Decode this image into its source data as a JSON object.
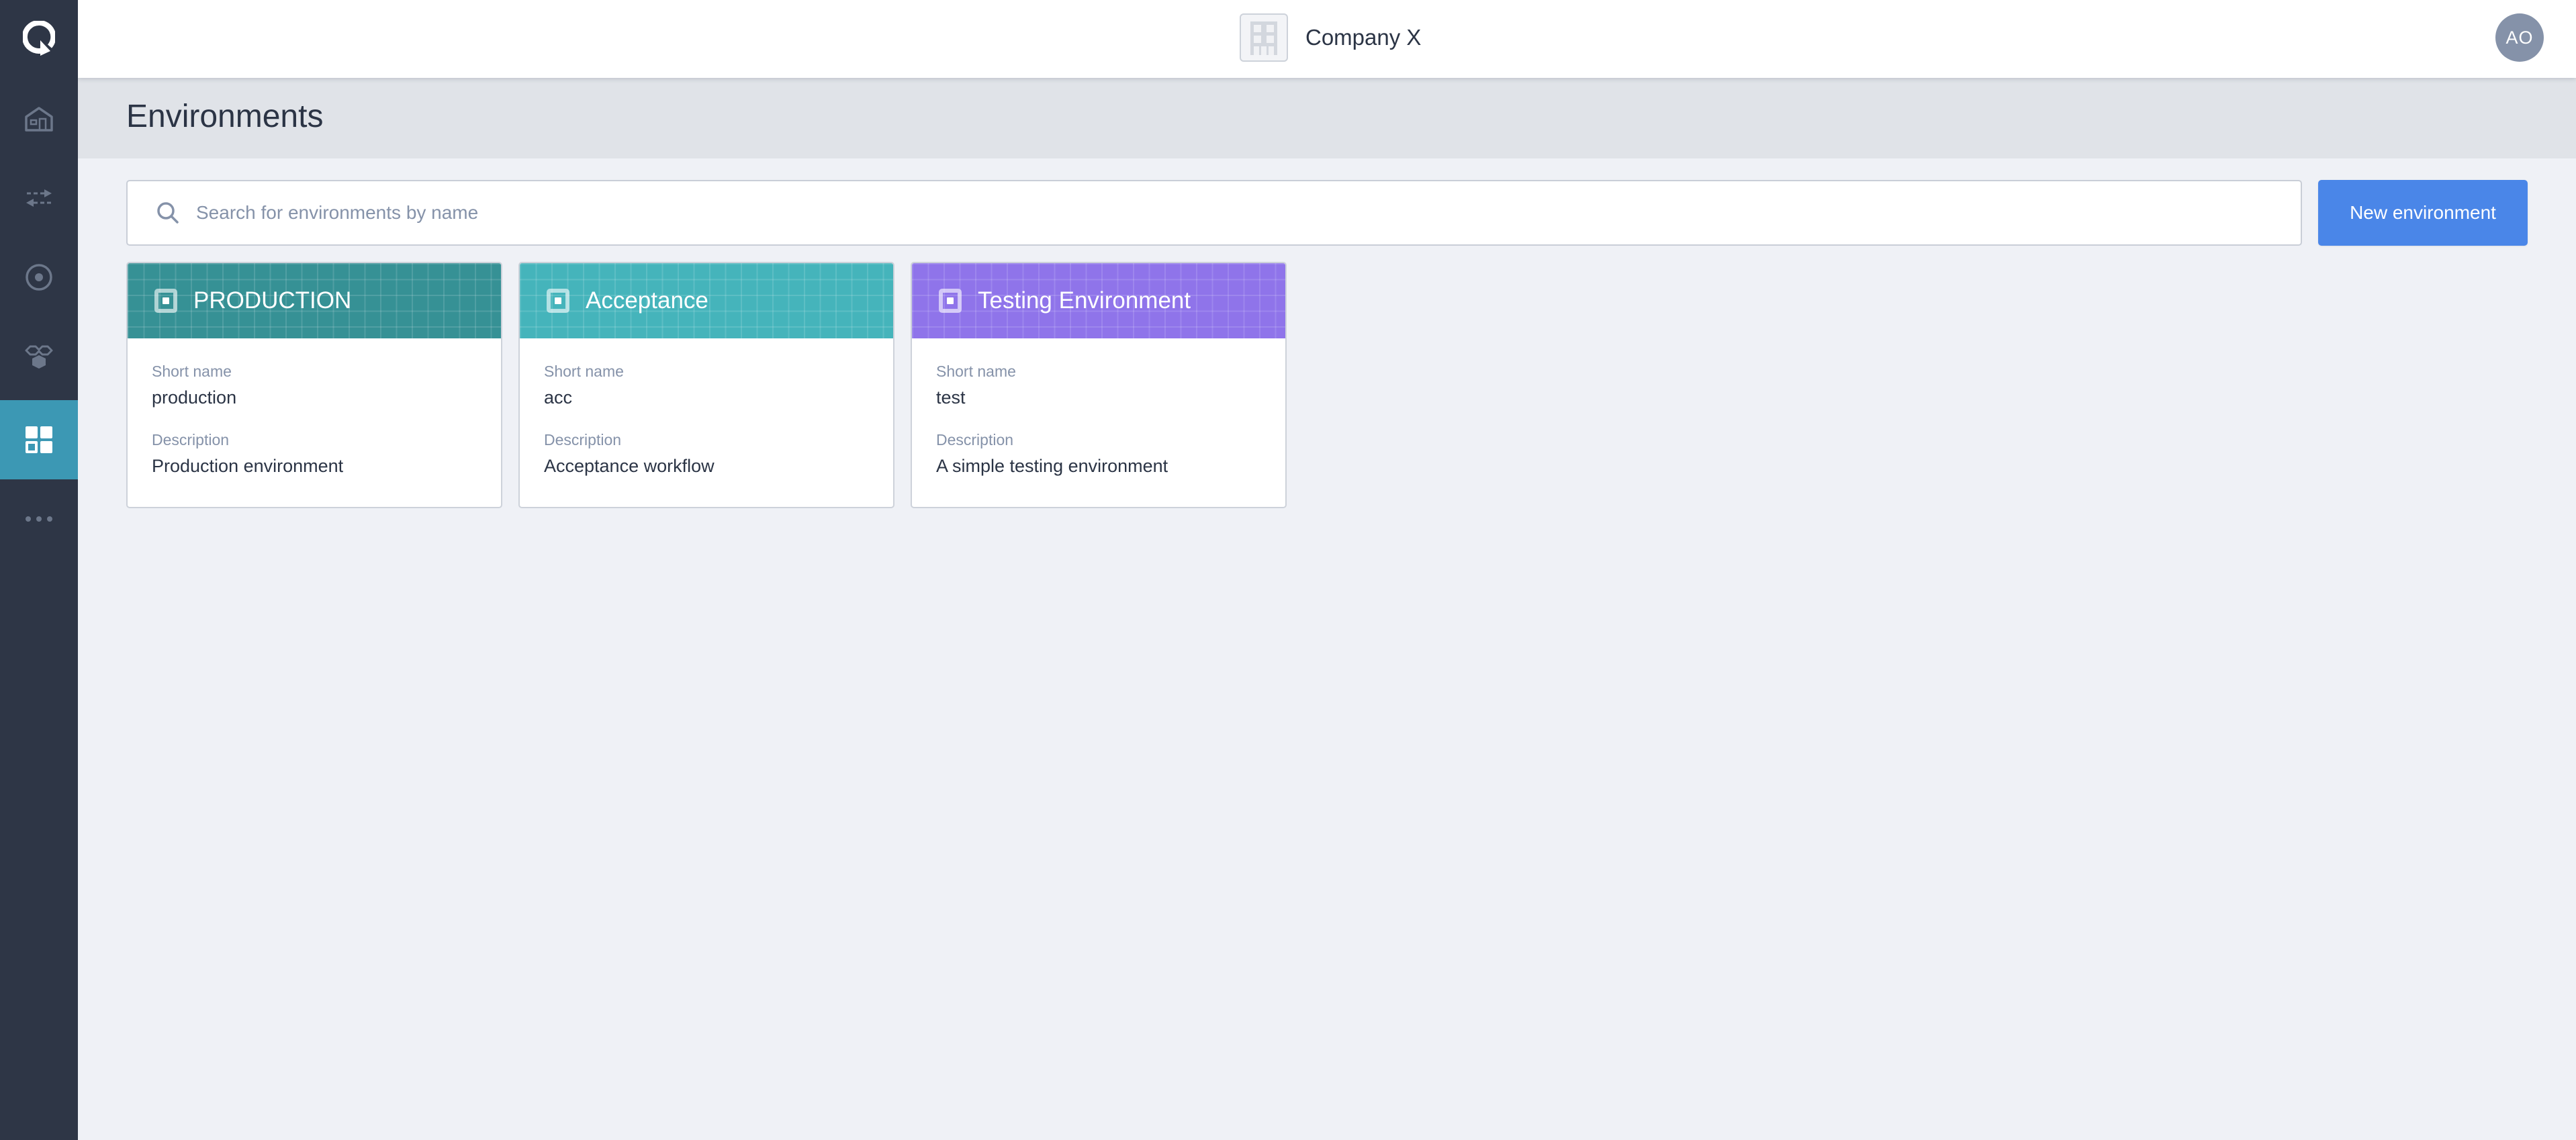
{
  "sidebar": {
    "logo_icon": "q-logo-icon",
    "items": [
      {
        "name": "home",
        "icon": "home-icon",
        "active": false
      },
      {
        "name": "transfers",
        "icon": "arrows-exchange-icon",
        "active": false
      },
      {
        "name": "target",
        "icon": "target-icon",
        "active": false
      },
      {
        "name": "modules",
        "icon": "hexagon-group-icon",
        "active": false
      },
      {
        "name": "environments",
        "icon": "grid-dashboard-icon",
        "active": true
      },
      {
        "name": "more",
        "icon": "more-horizontal-icon",
        "active": false
      }
    ]
  },
  "header": {
    "organization_name": "Company X",
    "organization_icon": "building-icon",
    "avatar_initials": "AO"
  },
  "page": {
    "title": "Environments"
  },
  "toolbar": {
    "search_placeholder": "Search for environments by name",
    "search_value": "",
    "new_button_label": "New environment"
  },
  "labels": {
    "short_name": "Short name",
    "description": "Description"
  },
  "environments": [
    {
      "title": "PRODUCTION",
      "short_name": "production",
      "description": "Production environment",
      "color": "#369195"
    },
    {
      "title": "Acceptance",
      "short_name": "acc",
      "description": "Acceptance workflow",
      "color": "#45b4bb"
    },
    {
      "title": "Testing Environment",
      "short_name": "test",
      "description": "A simple testing environment",
      "color": "#8f74ea"
    }
  ]
}
